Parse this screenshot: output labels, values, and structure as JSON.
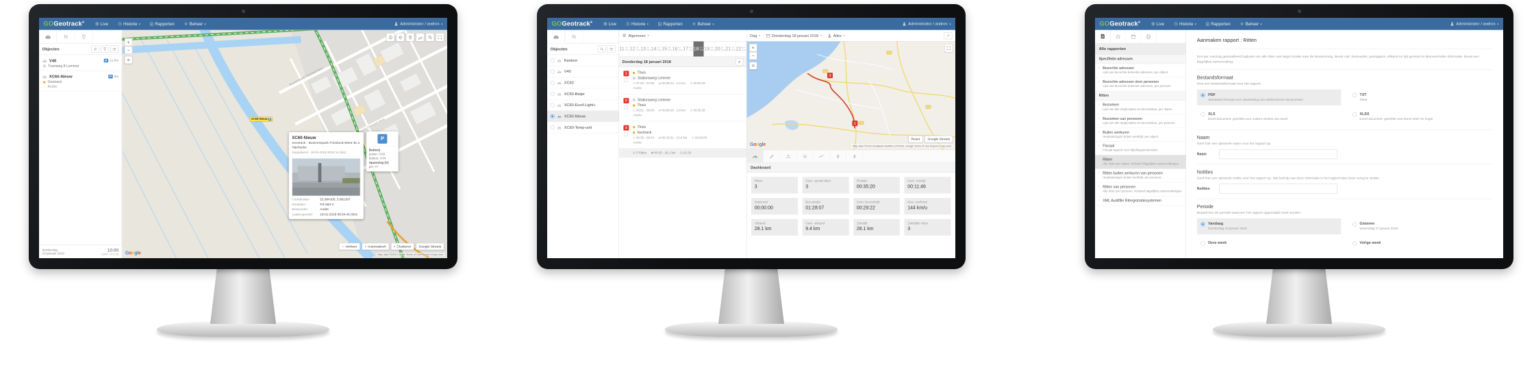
{
  "colors": {
    "navbar": "#3b6b9e",
    "logo_green": "#7dc242",
    "accent_blue": "#4a8fd3",
    "badge_red": "#dd3b2f",
    "dot_orange": "#f5a623",
    "selected_gray": "#6f6f6f",
    "marker_yellow": "#ffe94d",
    "radio_blue": "#2a8fe8"
  },
  "nav": {
    "go": "GO",
    "name": "Geotrack",
    "reg": "®",
    "live": "Live",
    "historie": "Historie",
    "rapporten": "Rapporten",
    "beheer": "Beheer",
    "caret": "▾",
    "user": "Administrator / andron"
  },
  "live": {
    "side": {
      "objects": "Objecten",
      "v40": {
        "name": "V40",
        "addr": "Tramweg 8 Lemmer",
        "p": "P",
        "time": "1u 6m"
      },
      "xc60": {
        "name": "XC60-Nieuw",
        "addr": "Geotrack",
        "driver": "Andre",
        "p": "P",
        "time": "6m"
      },
      "footer": {
        "day": "donderdag",
        "date": "18 januari 2018",
        "time": "10:00",
        "tz": "(GMT +01:00)"
      }
    },
    "map": {
      "zoom_in": "+",
      "zoom_out": "−",
      "street": "Businesspark Friesland-West",
      "marker": {
        "label": "XC60-Nieuw",
        "p": "P"
      },
      "popup": {
        "title": "XC60-Nieuw",
        "address": "Geotrack - Businesspark Friesland-West 35 a Nijehaske",
        "status": "Geparkeerd - 18-01-2018 09:54:14 (6m)",
        "rows": [
          {
            "label": "Coördinaten",
            "value": "52.984105, 5.891397"
          },
          {
            "label": "Kenteken",
            "value": "PS-593-V"
          },
          {
            "label": "Bestuurder",
            "value": "Andre"
          },
          {
            "label": "Laatst gemeld",
            "value": "18-01-2018 09:54:40 (3m)"
          }
        ]
      },
      "panel": {
        "p": "P",
        "batt_title": "Batterij",
        "power": "power: 0.59",
        "battery": "battery: 4.04",
        "span_title": "Spanning (V)",
        "pct": "pct: 77"
      },
      "google": [
        "G",
        "o",
        "o",
        "g",
        "l",
        "e"
      ],
      "buttons": [
        {
          "mark": "✓",
          "label": "Verkeer"
        },
        {
          "mark": "×",
          "label": "Automatisch"
        },
        {
          "mark": "×",
          "label": "Clusteren"
        },
        {
          "mark": "",
          "label": "Google Streets"
        }
      ],
      "attribution": "Map data ©2018 Google    Terms of Use    Report a map error"
    }
  },
  "historie": {
    "side": {
      "objects": "Objecten",
      "items": [
        "Kantoor",
        "V40",
        "XC60",
        "XC60-Beijer",
        "XC60-Eco4-Light+",
        "XC60-Nieuw",
        "XC60-Temp-unit"
      ],
      "selected": "XC60-Nieuw"
    },
    "toolbar": {
      "group": "Algemeen",
      "period": "Dag",
      "date": "Donderdag 18 januari 2018",
      "filter": "Alles",
      "export": "↗",
      "caret": "▾"
    },
    "month": "JAN",
    "dates": [
      {
        "n": "11",
        "d": "DO"
      },
      {
        "n": "12",
        "d": "VR"
      },
      {
        "n": "13",
        "d": "ZA"
      },
      {
        "n": "14",
        "d": "ZO"
      },
      {
        "n": "15",
        "d": "MA"
      },
      {
        "n": "16",
        "d": "DI"
      },
      {
        "n": "17",
        "d": "WO"
      },
      {
        "n": "18",
        "d": "DO"
      },
      {
        "n": "19",
        "d": "VR"
      },
      {
        "n": "20",
        "d": "ZA"
      },
      {
        "n": "21",
        "d": "ZO"
      },
      {
        "n": "22",
        "d": "MA"
      }
    ],
    "day_header": "Donderdag 18 januari 2018",
    "check": "✓",
    "icons": {
      "clock": "⊙",
      "swap": "⇄"
    },
    "trips": [
      {
        "num": "1",
        "from": "Thuis",
        "to": "Stationsweg Lemmer",
        "time": "07:50 - 07:59",
        "dist": "00:08:23 - 2.6 km",
        "stop": "00:52:28",
        "driver": "Andre"
      },
      {
        "num": "2",
        "from": "Stationsweg Lemmer",
        "to": "Thuis",
        "time": "08:51 - 09:00",
        "dist": "00:08:26 - 2.8 km",
        "stop": "00:35:38",
        "driver": "Andre"
      },
      {
        "num": "3",
        "from": "Thuis",
        "to": "Geotrack",
        "time": "09:35 - 09:54",
        "dist": "00:18:31 - 22.8 km",
        "stop": "00:00:00",
        "driver": "Andre"
      }
    ],
    "summary": {
      "rides": "3 Ritten",
      "dist": "00:35 - 28.1 km",
      "stop": "01:28"
    },
    "map": {
      "zoom_in": "+",
      "zoom_out": "−",
      "reset": "Reset",
      "streets": "Google Streets",
      "marker1": "1",
      "marker3": "3",
      "attribution": "Map data ©2018 GeoBasis-DE/BKG (©2009), Google    Terms of Use    Report a map error"
    },
    "dashboard_title": "Dashboard",
    "dashboard": [
      {
        "label": "Ritten",
        "value": "3"
      },
      {
        "label": "Gem. aantal ritten",
        "value": "3"
      },
      {
        "label": "Reistijd",
        "value": "00:35:20"
      },
      {
        "label": "Gem. reistijd",
        "value": "00:11:46"
      },
      {
        "label": "Stationair",
        "value": "00:00:00"
      },
      {
        "label": "Bezoektijd",
        "value": "01:28:07"
      },
      {
        "label": "Gem. bezoektijd",
        "value": "00:29:22"
      },
      {
        "label": "Max. snelheid",
        "value": "144 km/u"
      },
      {
        "label": "Afstand",
        "value": "28.1 km"
      },
      {
        "label": "Gem. afstand",
        "value": "9.4 km"
      },
      {
        "label": "Zakelijk",
        "value": "28.1 km"
      },
      {
        "label": "Zakelijke ritten",
        "value": "3"
      }
    ]
  },
  "rapporten": {
    "side": {
      "all": "Alle rapporten",
      "sec1": "Specifieke adressen",
      "list1": [
        {
          "t": "Bezochte adressen",
          "d": "Lijst van bezochte bekende adressen, per object."
        },
        {
          "t": "Bezochte adressen door personen",
          "d": "Lijst van bezochte bekende adressen, per persoon."
        }
      ],
      "sec2": "Ritten",
      "list2": [
        {
          "t": "Bezoeken",
          "d": "Lijst van alle stoplocaties en bezoekduur, per object."
        },
        {
          "t": "Bezoeken van personen",
          "d": "Lijst van alle stoplocaties en bezoekduur, per persoon."
        },
        {
          "t": "Buiten werkuren",
          "d": "Verplaatsingen buiten werktijd, per object."
        },
        {
          "t": "Fiscaal",
          "d": "Fiscaal rapport voor bijtellingsdoeleinden."
        },
        {
          "t": "Ritten",
          "d": "Alle ritten per object, inclusief dagelijkse samenvattingen."
        },
        {
          "t": "Ritten buiten werkuren van personen",
          "d": "Verplaatsingen buiten werktijd, per persoon."
        },
        {
          "t": "Ritten van personen",
          "d": "Alle ritten per persoon, inclusief dagelijkse samenvattingen."
        },
        {
          "t": "XML Auditfile Ritregistratiesystemen",
          "d": ""
        }
      ]
    },
    "main": {
      "title": "Aanmaken rapport : Ritten",
      "description": "Een per voertuig gedetailleerd logboek van alle ritten van begin locatie naar de bestemming. Bevat ook: bestuurder, passagiers, afstand en tijd gereisd en kilometerteller informatie. Bevat een dagelijkse samenvatting.",
      "format": {
        "title": "Bestandsformaat",
        "sub": "Kies een bestandsformaat voor het rapport.",
        "options": [
          {
            "label": "PDF",
            "desc": "Standaard formaat voor uitwisseling van elektronische documenten"
          },
          {
            "label": "TXT",
            "desc": "Tekst"
          },
          {
            "label": "XLS",
            "desc": "Excel document, geschikt voor oudere versies van excel"
          },
          {
            "label": "XLSX",
            "desc": "Excel document, geschikt voor Excel 2007 en hoger"
          }
        ]
      },
      "naam": {
        "title": "Naam",
        "sub": "Geef hier een optionele naam voor het rapport op.",
        "label": "Naam"
      },
      "notities": {
        "title": "Notities",
        "sub": "Geef hier een optionele notitie voor het rapport op. Met behulp van deze informatie is het rapport later beter terug te vinden.",
        "label": "Notities"
      },
      "periode": {
        "title": "Periode",
        "sub": "Bepaal hier de periode waarover het rapport opgemaakt moet worden.",
        "options": [
          {
            "label": "Vandaag",
            "desc": "Donderdag 18 januari 2018"
          },
          {
            "label": "Gisteren",
            "desc": "Woensdag 17 januari 2018"
          },
          {
            "label": "Deze week",
            "desc": ""
          },
          {
            "label": "Vorige week",
            "desc": ""
          }
        ]
      }
    }
  }
}
